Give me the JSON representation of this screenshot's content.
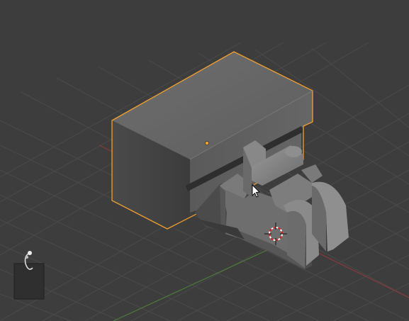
{
  "viewport": {
    "view_name": "",
    "background": "#3d3d3d",
    "grid_color": "#4a4a4a",
    "axis_x_color": "#8a3a3a",
    "axis_y_color": "#4c7a3a",
    "selection_outline_color": "#f0a030"
  },
  "objects": [
    {
      "name": "box",
      "selected": true
    },
    {
      "name": "clamp",
      "selected": false
    }
  ],
  "icons": [
    "3d-cursor-icon",
    "mouse-cursor-icon",
    "camera-widget-icon",
    "object-origin-icon"
  ]
}
